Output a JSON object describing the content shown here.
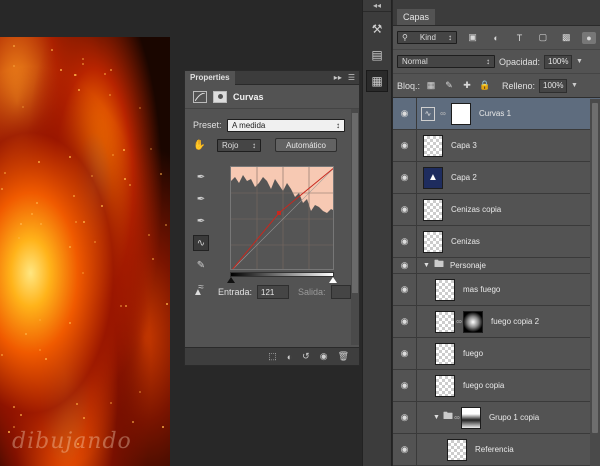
{
  "canvas": {
    "watermark": "dibujando"
  },
  "properties": {
    "tab": "Properties",
    "title": "Curvas",
    "preset_label": "Preset:",
    "preset_value": "A medida",
    "channel_value": "Rojo",
    "auto_button": "Automático",
    "input_label": "Entrada:",
    "input_value": "121",
    "output_label": "Salida:",
    "output_value": ""
  },
  "layers_panel": {
    "tab": "Capas",
    "filter_kind": "Kind",
    "blend_mode": "Normal",
    "opacity_label": "Opacidad:",
    "opacity_value": "100%",
    "lock_label": "Bloq.:",
    "fill_label": "Relleno:",
    "fill_value": "100%",
    "layers": [
      {
        "name": "Curvas 1",
        "type": "adjustment",
        "selected": true
      },
      {
        "name": "Capa 3",
        "type": "transparent"
      },
      {
        "name": "Capa 2",
        "type": "navy"
      },
      {
        "name": "Cenizas copia",
        "type": "transparent"
      },
      {
        "name": "Cenizas",
        "type": "transparent"
      },
      {
        "name": "Personaje",
        "type": "group"
      },
      {
        "name": "mas fuego",
        "type": "transparent"
      },
      {
        "name": "fuego copia 2",
        "type": "masked"
      },
      {
        "name": "fuego",
        "type": "transparent"
      },
      {
        "name": "fuego copia",
        "type": "transparent"
      },
      {
        "name": "Grupo 1 copia",
        "type": "group-masked"
      },
      {
        "name": "Referencia",
        "type": "transparent"
      }
    ]
  }
}
